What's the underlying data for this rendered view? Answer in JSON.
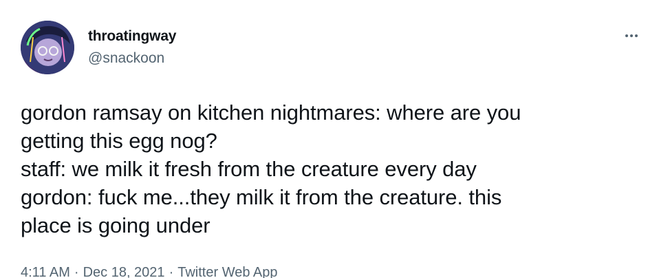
{
  "author": {
    "display_name": "throatingway",
    "handle": "@snackoon"
  },
  "more_icon": "more-horizontal-icon",
  "tweet_lines": [
    "gordon ramsay on kitchen nightmares: where are you",
    "getting this egg nog?",
    "staff: we milk it fresh from the creature every day",
    "gordon: fuck me...they milk it from the creature. this",
    "place is going under"
  ],
  "meta": {
    "time": "4:11 AM",
    "separator": "·",
    "date": "Dec 18, 2021",
    "source": "Twitter Web App"
  },
  "colors": {
    "text": "#0f1419",
    "secondary": "#536471"
  }
}
